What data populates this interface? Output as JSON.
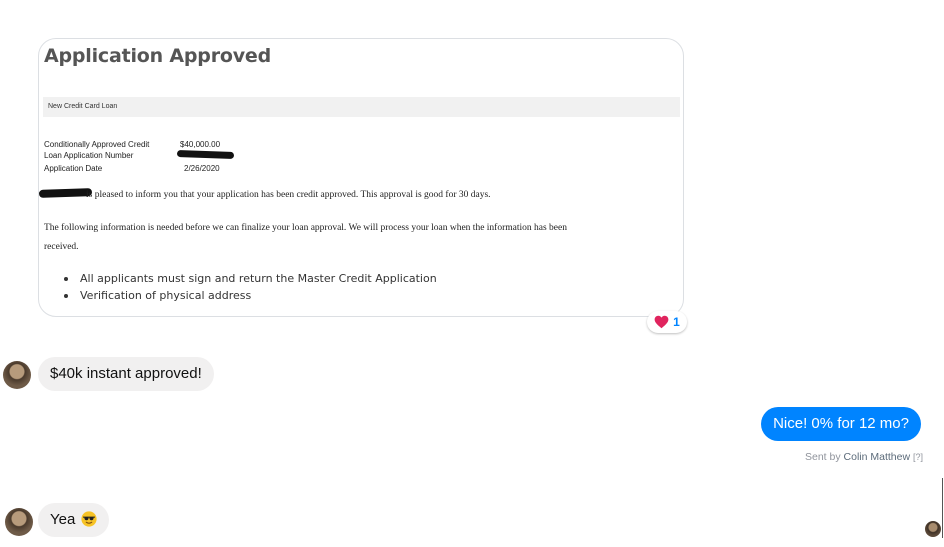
{
  "attachment": {
    "title": "Application Approved",
    "band_text": "New Credit Card Loan",
    "fields": [
      {
        "label": "Conditionally Approved Credit",
        "value": "$40,000.00"
      },
      {
        "label": "Loan Application Number",
        "value": ""
      },
      {
        "label": "Application Date",
        "value": "2/26/2020"
      }
    ],
    "line1": "is pleased to inform you that your application has been credit approved. This approval is good for 30 days.",
    "line2": "The following information is needed before we can finalize your loan approval. We will process your loan when the information has been",
    "line3": "received.",
    "bullets": [
      "All applicants must sign and return the Master Credit Application",
      "Verification of physical address"
    ]
  },
  "reaction": {
    "icon": "heart-icon",
    "count": "1",
    "color": "#e0245e"
  },
  "messages": [
    {
      "from": "other",
      "text": "$40k instant approved!"
    },
    {
      "from": "me",
      "text": "Nice! 0% for 12 mo?"
    },
    {
      "from": "other",
      "text": "Yea",
      "emoji": "sunglasses-emoji"
    }
  ],
  "sent_by": {
    "prefix": "Sent by",
    "name": "Colin Matthew",
    "help": "[?]"
  },
  "colors": {
    "outgoing_bubble": "#0084ff",
    "incoming_bubble": "#f1f0f0",
    "link_blue": "#0084ff"
  }
}
